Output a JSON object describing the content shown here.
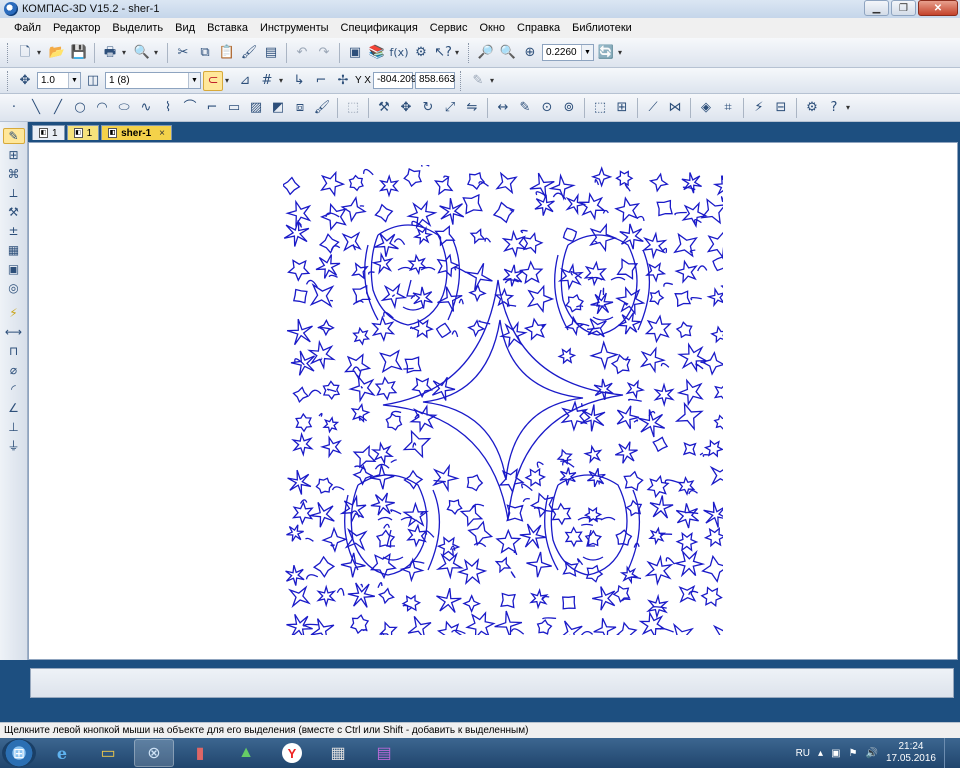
{
  "window": {
    "title": "КОМПАС-3D V15.2  - sher-1",
    "minimize_icon": "minimize-icon",
    "maximize_icon": "restore-icon",
    "close_icon": "close-icon"
  },
  "menu": [
    "Файл",
    "Редактор",
    "Выделить",
    "Вид",
    "Вставка",
    "Инструменты",
    "Спецификация",
    "Сервис",
    "Окно",
    "Справка",
    "Библиотеки"
  ],
  "toolbar1": {
    "zoom_value": "0.2260"
  },
  "toolbar2": {
    "step_value": "1.0",
    "layer_value": "1 (8)",
    "coord_x": "-804.209",
    "coord_y": "858.663",
    "xy_label": "Y X"
  },
  "tabs": [
    {
      "label": "1"
    },
    {
      "label": "1"
    },
    {
      "label": "sher-1",
      "close": "×"
    }
  ],
  "status_text": "Щелкните левой кнопкой мыши на объекте для его выделения (вместе с Ctrl или Shift - добавить к выделенным)",
  "taskbar": {
    "language": "RU",
    "time": "21:24",
    "date": "17.05.2016",
    "apps": [
      "internet-explorer-icon",
      "explorer-icon",
      "kompas-icon",
      "phone-icon",
      "image-editor-icon",
      "yandex-icon",
      "calculator-icon",
      "winrar-icon"
    ]
  },
  "colors": {
    "drawing_stroke": "#1a1ac8",
    "workspace_bg": "#1d4f80",
    "active_tab": "#f4d24a"
  }
}
